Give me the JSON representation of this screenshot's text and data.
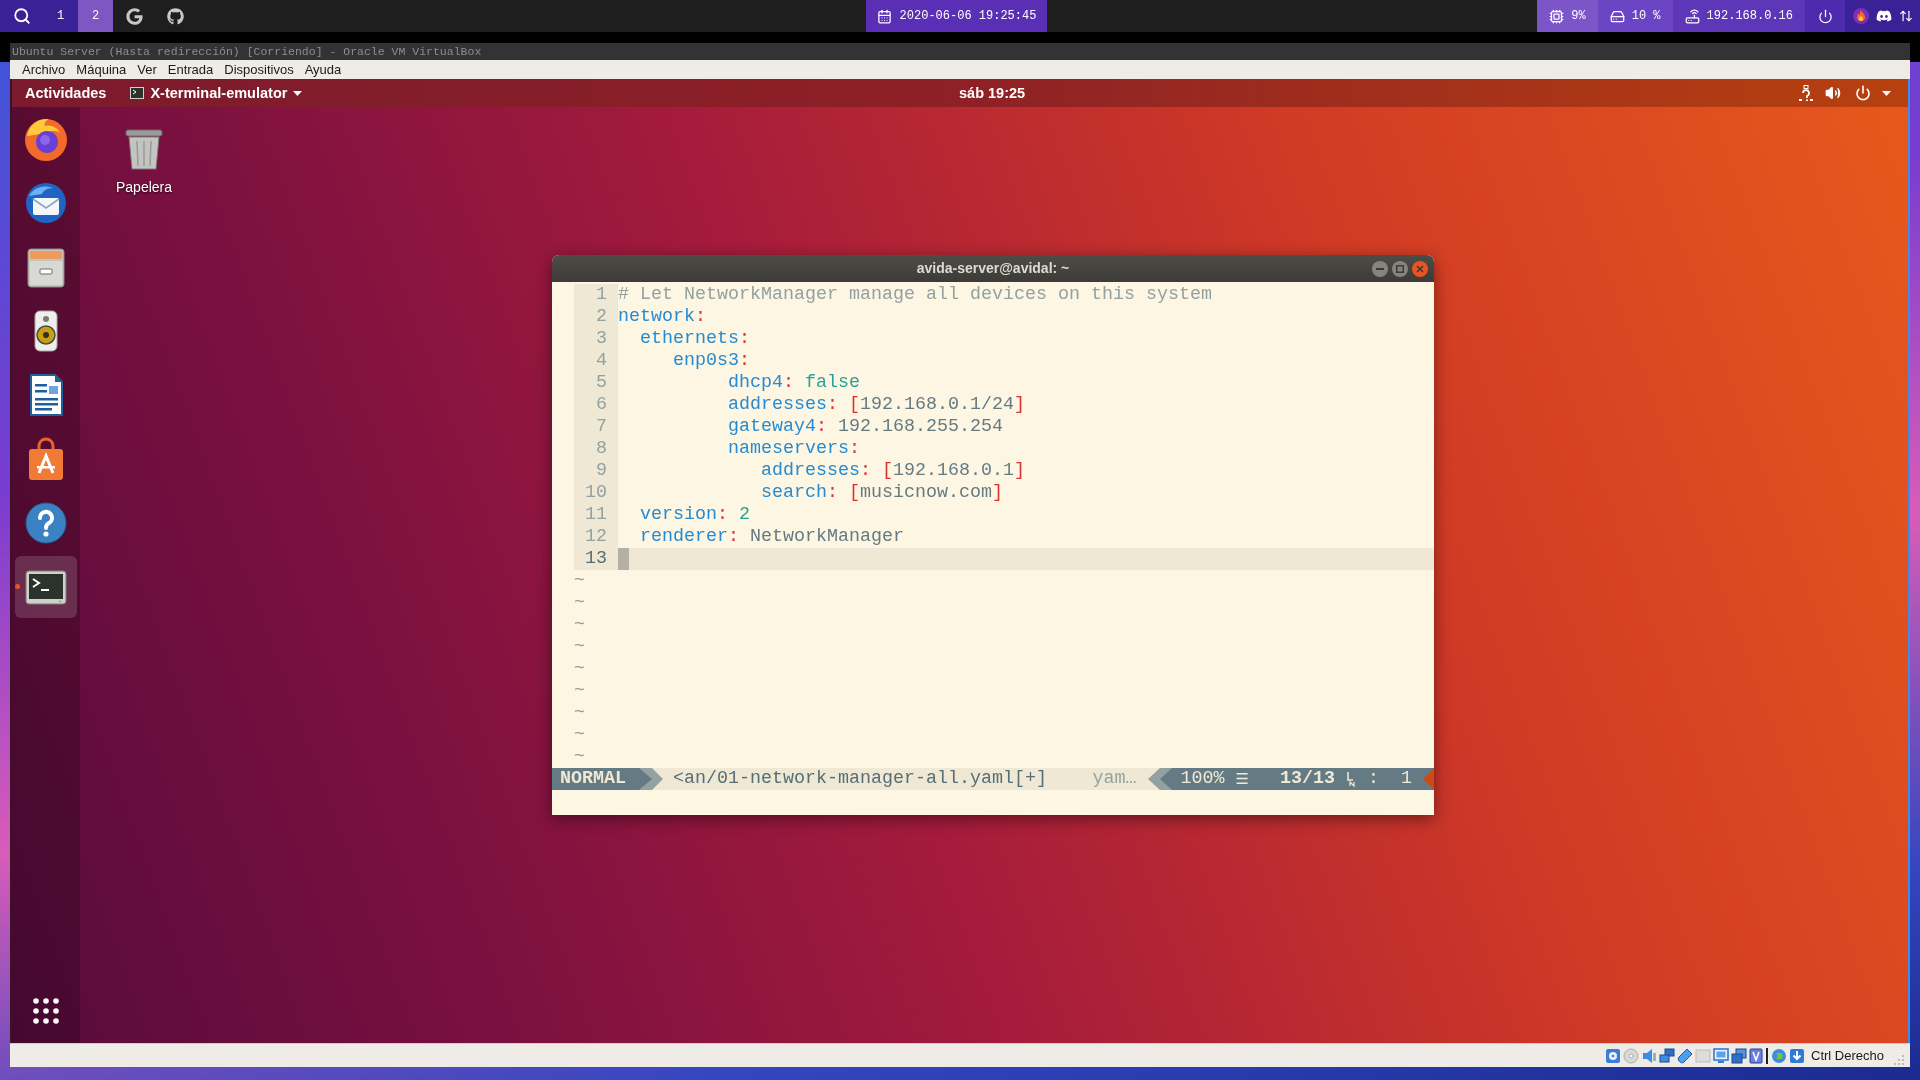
{
  "host_bar": {
    "workspaces": [
      {
        "label": "1",
        "selected": false
      },
      {
        "label": "2",
        "selected": true
      }
    ],
    "clock": "2020-06-06 19:25:45",
    "indicators": [
      {
        "kind": "cpu",
        "text": "9%"
      },
      {
        "kind": "disk",
        "text": "10 %"
      },
      {
        "kind": "network",
        "text": "192.168.0.16"
      }
    ]
  },
  "vm_window": {
    "title": "Ubuntu Server (Hasta redirección) [Corriendo] - Oracle VM VirtualBox",
    "menu": [
      "Archivo",
      "Máquina",
      "Ver",
      "Entrada",
      "Dispositivos",
      "Ayuda"
    ],
    "host_key": "Ctrl Derecho"
  },
  "top_bar": {
    "activities": "Actividades",
    "app_menu": "X-terminal-emulator",
    "clock": "sáb 19:25"
  },
  "dock": [
    {
      "kind": "browser",
      "running": false
    },
    {
      "kind": "mail",
      "running": false
    },
    {
      "kind": "files",
      "running": false
    },
    {
      "kind": "music",
      "running": false
    },
    {
      "kind": "writer",
      "running": false
    },
    {
      "kind": "software",
      "running": false
    },
    {
      "kind": "help",
      "running": false
    },
    {
      "kind": "terminal",
      "running": true
    }
  ],
  "desktop_icons": [
    {
      "kind": "trash",
      "label": "Papelera"
    }
  ],
  "terminal": {
    "title": "avida-server@avidal: ~",
    "lines": [
      {
        "number": "1",
        "current": false,
        "tokens": [
          {
            "kind": "comment",
            "text": "# Let NetworkManager manage all devices on this system"
          }
        ]
      },
      {
        "number": "2",
        "current": false,
        "tokens": [
          {
            "kind": "key",
            "text": "network"
          },
          {
            "kind": "colon",
            "text": ":"
          }
        ]
      },
      {
        "number": "3",
        "current": false,
        "tokens": [
          {
            "kind": "key",
            "text": "  ethernets"
          },
          {
            "kind": "colon",
            "text": ":"
          }
        ]
      },
      {
        "number": "4",
        "current": false,
        "tokens": [
          {
            "kind": "key",
            "text": "     enp0s3"
          },
          {
            "kind": "colon",
            "text": ":"
          }
        ]
      },
      {
        "number": "5",
        "current": false,
        "tokens": [
          {
            "kind": "key",
            "text": "          dhcp4"
          },
          {
            "kind": "colon",
            "text": ": "
          },
          {
            "kind": "constant",
            "text": "false"
          }
        ]
      },
      {
        "number": "6",
        "current": false,
        "tokens": [
          {
            "kind": "key",
            "text": "          addresses"
          },
          {
            "kind": "colon",
            "text": ": "
          },
          {
            "kind": "bracket",
            "text": "["
          },
          {
            "kind": "value",
            "text": "192.168.0.1/24"
          },
          {
            "kind": "bracket",
            "text": "]"
          }
        ]
      },
      {
        "number": "7",
        "current": false,
        "tokens": [
          {
            "kind": "key",
            "text": "          gateway4"
          },
          {
            "kind": "colon",
            "text": ": "
          },
          {
            "kind": "value",
            "text": "192.168.255.254"
          }
        ]
      },
      {
        "number": "8",
        "current": false,
        "tokens": [
          {
            "kind": "key",
            "text": "          nameservers"
          },
          {
            "kind": "colon",
            "text": ":"
          }
        ]
      },
      {
        "number": "9",
        "current": false,
        "tokens": [
          {
            "kind": "key",
            "text": "             addresses"
          },
          {
            "kind": "colon",
            "text": ": "
          },
          {
            "kind": "bracket",
            "text": "["
          },
          {
            "kind": "value",
            "text": "192.168.0.1"
          },
          {
            "kind": "bracket",
            "text": "]"
          }
        ]
      },
      {
        "number": "10",
        "current": false,
        "tokens": [
          {
            "kind": "key",
            "text": "             search"
          },
          {
            "kind": "colon",
            "text": ": "
          },
          {
            "kind": "bracket",
            "text": "["
          },
          {
            "kind": "value",
            "text": "musicnow.com"
          },
          {
            "kind": "bracket",
            "text": "]"
          }
        ]
      },
      {
        "number": "11",
        "current": false,
        "tokens": [
          {
            "kind": "key",
            "text": "  version"
          },
          {
            "kind": "colon",
            "text": ": "
          },
          {
            "kind": "constant",
            "text": "2"
          }
        ]
      },
      {
        "number": "12",
        "current": false,
        "tokens": [
          {
            "kind": "key",
            "text": "  renderer"
          },
          {
            "kind": "colon",
            "text": ": "
          },
          {
            "kind": "value",
            "text": "NetworkManager"
          }
        ]
      },
      {
        "number": "13",
        "current": true
      }
    ],
    "filler": [
      "~",
      "~",
      "~",
      "~",
      "~",
      "~",
      "~",
      "~",
      "~"
    ],
    "status_line": {
      "mode": "NORMAL",
      "file": "<an/01-network-manager-all.yaml[+]",
      "filetype": "yam…",
      "percent": "100%",
      "glyph": "☰",
      "position": "13/13",
      "separator": ":",
      "column": "1"
    }
  }
}
